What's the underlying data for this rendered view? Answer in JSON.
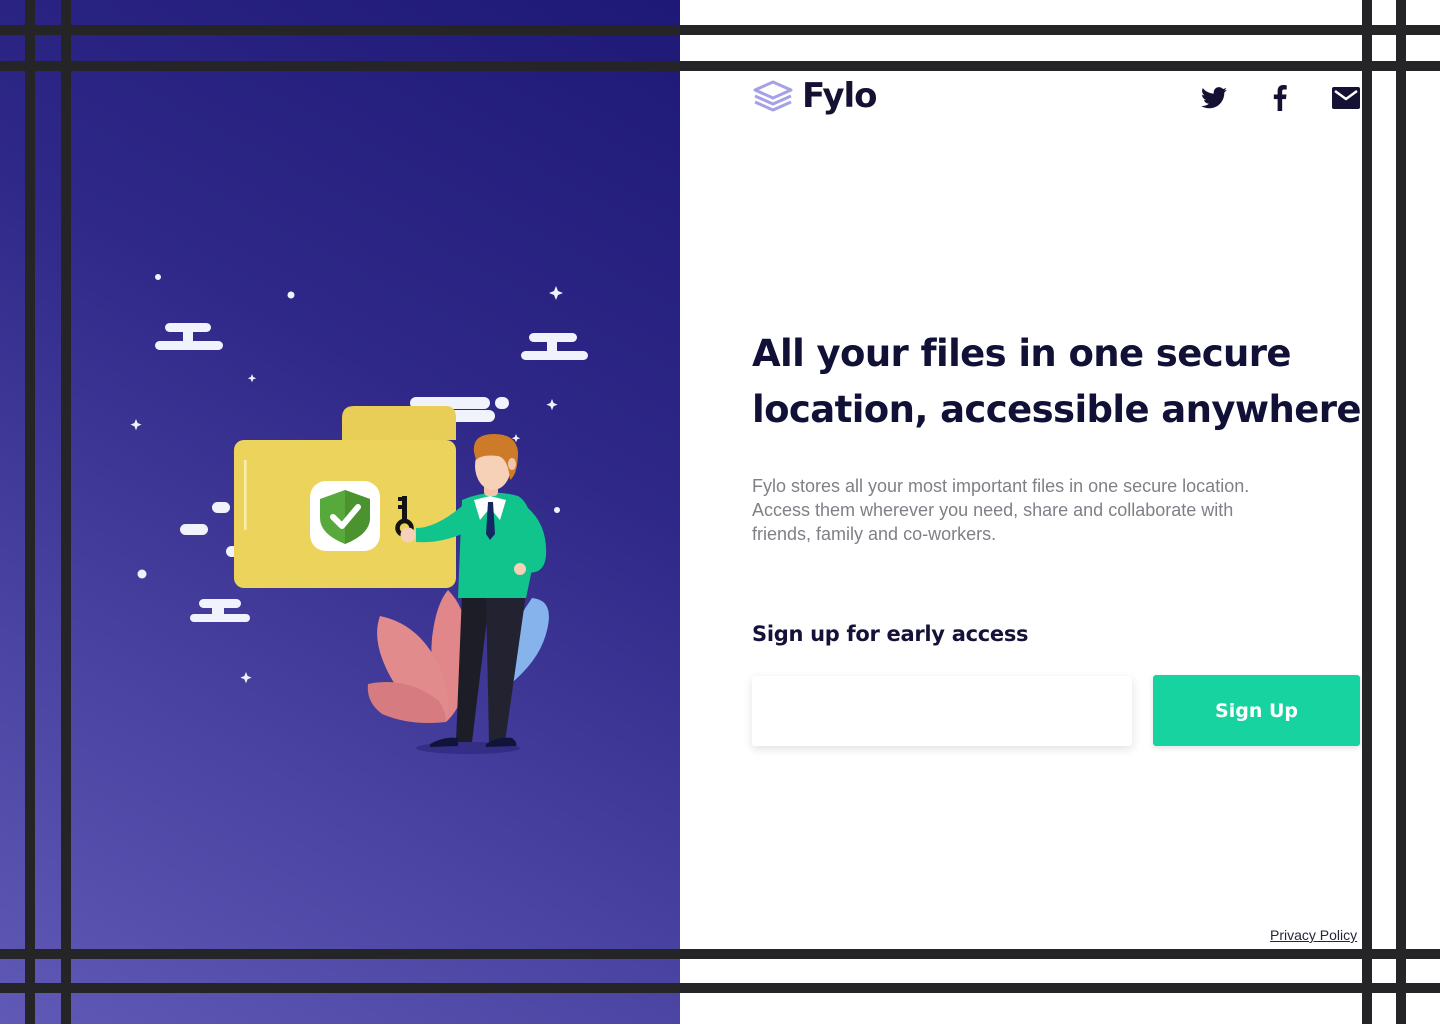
{
  "brand": {
    "name": "Fylo",
    "logo_icon": "layers-icon",
    "logo_color": "#a5a1e7"
  },
  "social_links": [
    {
      "icon": "twitter-icon"
    },
    {
      "icon": "facebook-icon"
    },
    {
      "icon": "email-icon"
    }
  ],
  "hero": {
    "headline_line1": "All your files in one secure",
    "headline_line2": "location, accessible anywhere.",
    "description_line1": "Fylo stores all your most important files in one secure location.",
    "description_line2": "Access them wherever you need, share and collaborate with",
    "description_line3": "friends, family and co-workers."
  },
  "signup": {
    "title": "Sign up for early access",
    "email_value": "",
    "button_label": "Sign Up"
  },
  "footer": {
    "privacy_label": "Privacy Policy"
  },
  "colors": {
    "primary_dark": "#141132",
    "accent_green": "#16d3a0",
    "gradient_top": "#1e1876",
    "gradient_bottom": "#6059b5"
  }
}
